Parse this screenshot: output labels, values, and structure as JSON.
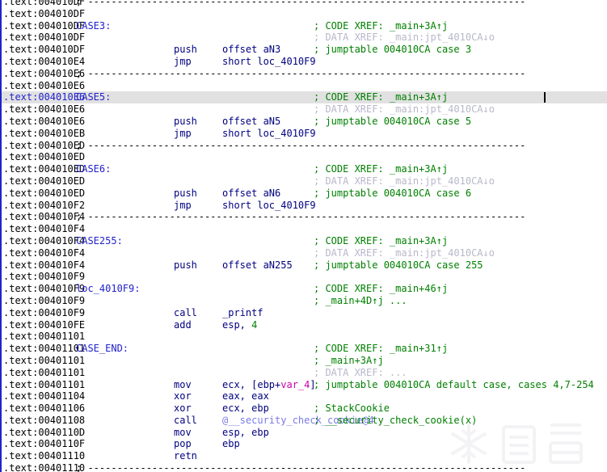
{
  "app": {
    "name": "IDA Pro disassembly view",
    "segment": "text",
    "highlighted_address": "004010E6",
    "colors": {
      "address": "#000000",
      "label": "#2222cc",
      "mnemonic": "#000080",
      "operand": "#000080",
      "number": "#008000",
      "variable": "#cc00aa",
      "function_ref": "#7a7aea",
      "comment": "#008000",
      "data_xref": "#b8b8cc",
      "highlight_bg": "#e1e1e1",
      "background": "#ffffff"
    },
    "watermark": "看雪"
  },
  "separator_text": "; ---------------------------------------------------------------------------",
  "lines": [
    {
      "addr": ".text:004010DF",
      "sep": "; ---------------------------------------------------------------------------",
      "clip_top": true
    },
    {
      "addr": ".text:004010DF"
    },
    {
      "addr": ".text:004010DF",
      "label": "CASE3:",
      "comment": "; CODE XREF: _main+3A↑j"
    },
    {
      "addr": ".text:004010DF",
      "dataxref": "; DATA XREF: _main:jpt_4010CA↓o"
    },
    {
      "addr": ".text:004010DF",
      "mnem": "push",
      "ops": "offset aN3",
      "comment": "; jumptable 004010CA case 3"
    },
    {
      "addr": ".text:004010E4",
      "mnem": "jmp",
      "ops": "short loc_4010F9"
    },
    {
      "addr": ".text:004010E6",
      "sep": "; ---------------------------------------------------------------------------"
    },
    {
      "addr": ".text:004010E6"
    },
    {
      "addr": ".text:004010E6",
      "label": "CASE5:",
      "comment": "; CODE XREF: _main+3A↑j",
      "highlight": true,
      "caret": true
    },
    {
      "addr": ".text:004010E6",
      "dataxref": "; DATA XREF: _main:jpt_4010CA↓o"
    },
    {
      "addr": ".text:004010E6",
      "mnem": "push",
      "ops": "offset aN5",
      "comment": "; jumptable 004010CA case 5"
    },
    {
      "addr": ".text:004010EB",
      "mnem": "jmp",
      "ops": "short loc_4010F9"
    },
    {
      "addr": ".text:004010ED",
      "sep": "; ---------------------------------------------------------------------------"
    },
    {
      "addr": ".text:004010ED"
    },
    {
      "addr": ".text:004010ED",
      "label": "CASE6:",
      "comment": "; CODE XREF: _main+3A↑j"
    },
    {
      "addr": ".text:004010ED",
      "dataxref": "; DATA XREF: _main:jpt_4010CA↓o"
    },
    {
      "addr": ".text:004010ED",
      "mnem": "push",
      "ops": "offset aN6",
      "comment": "; jumptable 004010CA case 6"
    },
    {
      "addr": ".text:004010F2",
      "mnem": "jmp",
      "ops": "short loc_4010F9"
    },
    {
      "addr": ".text:004010F4",
      "sep": "; ---------------------------------------------------------------------------"
    },
    {
      "addr": ".text:004010F4"
    },
    {
      "addr": ".text:004010F4",
      "label": "CASE255:",
      "comment": "; CODE XREF: _main+3A↑j"
    },
    {
      "addr": ".text:004010F4",
      "dataxref": "; DATA XREF: _main:jpt_4010CA↓o"
    },
    {
      "addr": ".text:004010F4",
      "mnem": "push",
      "ops": "offset aN255",
      "comment": "; jumptable 004010CA case 255"
    },
    {
      "addr": ".text:004010F9"
    },
    {
      "addr": ".text:004010F9",
      "label": "loc_4010F9:",
      "comment": "; CODE XREF: _main+46↑j"
    },
    {
      "addr": ".text:004010F9",
      "comment": "; _main+4D↑j ..."
    },
    {
      "addr": ".text:004010F9",
      "mnem": "call",
      "ops": "_printf"
    },
    {
      "addr": ".text:004010FE",
      "mnem": "add",
      "ops": "esp, 4",
      "num_tail": "4"
    },
    {
      "addr": ".text:00401101"
    },
    {
      "addr": ".text:00401101",
      "label": "CASE_END:",
      "comment": "; CODE XREF: _main+31↑j"
    },
    {
      "addr": ".text:00401101",
      "comment": "; _main+3A↑j"
    },
    {
      "addr": ".text:00401101",
      "dataxref": "; DATA XREF: ..."
    },
    {
      "addr": ".text:00401101",
      "mnem": "mov",
      "ops": "ecx, [ebp+var_4]",
      "var": "var_4",
      "comment": "; jumptable 004010CA default case, cases 4,7-254"
    },
    {
      "addr": ".text:00401104",
      "mnem": "xor",
      "ops": "eax, eax"
    },
    {
      "addr": ".text:00401106",
      "mnem": "xor",
      "ops": "ecx, ebp",
      "comment": "; StackCookie"
    },
    {
      "addr": ".text:00401108",
      "mnem": "call",
      "ops": "@__security_check_cookie@4",
      "func": true,
      "comment": "; __security_check_cookie(x)"
    },
    {
      "addr": ".text:0040110D",
      "mnem": "mov",
      "ops": "esp, ebp"
    },
    {
      "addr": ".text:0040110F",
      "mnem": "pop",
      "ops": "ebp"
    },
    {
      "addr": ".text:00401110",
      "mnem": "retn"
    },
    {
      "addr": ".text:00401110",
      "sep": "; ---------------------------------------------------------------------------",
      "clip_bottom": true
    }
  ]
}
